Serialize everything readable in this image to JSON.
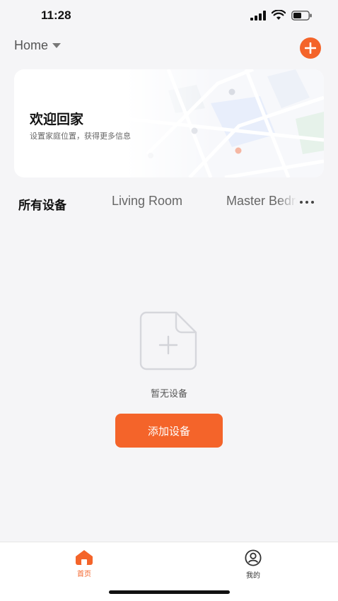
{
  "status_bar": {
    "time": "11:28"
  },
  "header": {
    "home_label": "Home"
  },
  "welcome_card": {
    "title": "欢迎回家",
    "subtitle": "设置家庭位置，获得更多信息"
  },
  "room_tabs": [
    {
      "label": "所有设备"
    },
    {
      "label": "Living Room"
    },
    {
      "label": "Master Bedroom"
    }
  ],
  "empty_state": {
    "message": "暂无设备",
    "button_label": "添加设备"
  },
  "bottom_nav": [
    {
      "label": "首页"
    },
    {
      "label": "我的"
    }
  ],
  "colors": {
    "accent": "#f4642a",
    "background": "#f5f5f7",
    "card": "#ffffff"
  },
  "icons": [
    "cellular-signal-icon",
    "wifi-icon",
    "battery-icon",
    "chevron-down-icon",
    "plus-icon",
    "more-icon",
    "empty-document-icon",
    "home-icon",
    "profile-icon"
  ]
}
